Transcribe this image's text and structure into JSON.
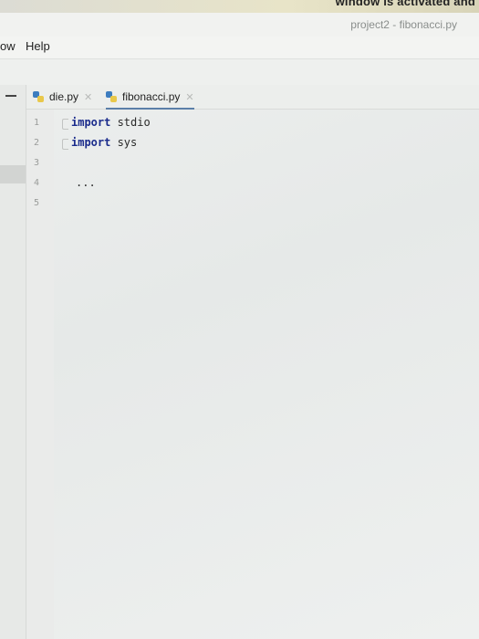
{
  "banner": {
    "text": "window is activated and"
  },
  "window": {
    "title": "project2 - fibonacci.py"
  },
  "menu": {
    "items": [
      "ow",
      "Help"
    ]
  },
  "tabs": [
    {
      "label": "die.py",
      "active": false
    },
    {
      "label": "fibonacci.py",
      "active": true
    }
  ],
  "editor": {
    "line_numbers": [
      "1",
      "2",
      "3",
      "4",
      "5"
    ],
    "lines": [
      {
        "keyword": "import",
        "rest": " stdio"
      },
      {
        "keyword": "import",
        "rest": " sys"
      }
    ],
    "ellipsis": "..."
  },
  "icons": {
    "tab_icon": "python-file-icon",
    "close": "close-icon"
  },
  "colors": {
    "accent": "#5b7fa8",
    "keyword": "#1b2c8c"
  }
}
